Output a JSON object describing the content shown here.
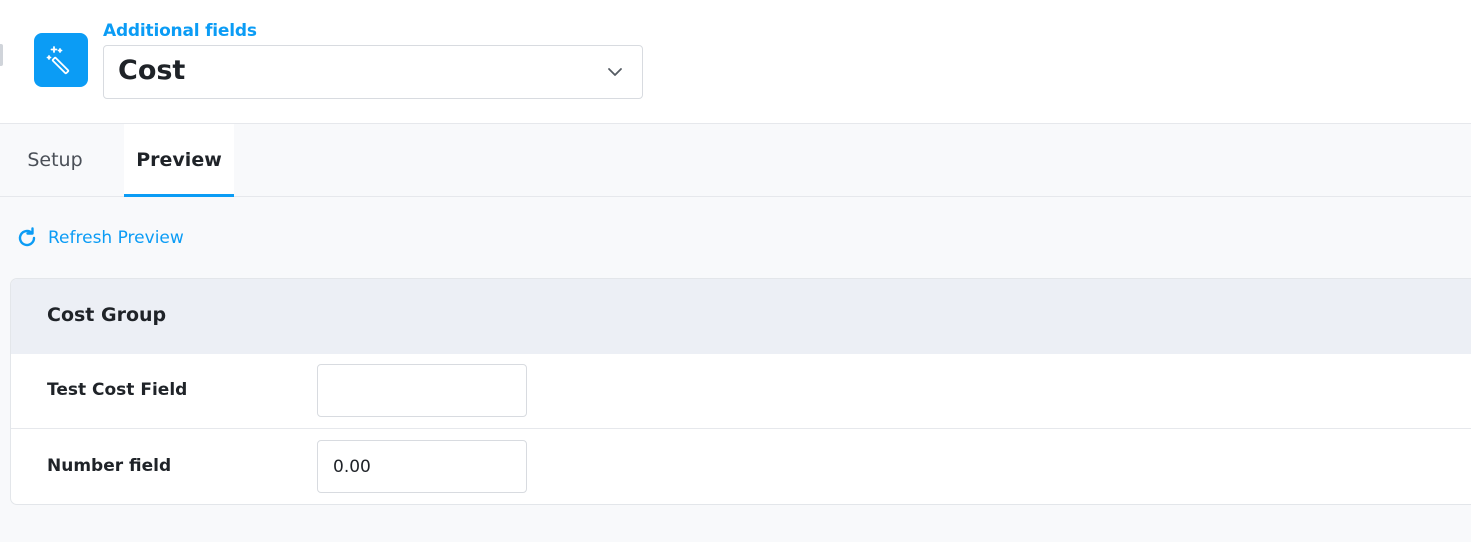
{
  "header": {
    "eyebrow": "Additional fields",
    "selected_field": "Cost",
    "app_icon": "magic-wand-icon",
    "accent_color": "#0b9cf5"
  },
  "tabs": [
    {
      "label": "Setup",
      "active": false
    },
    {
      "label": "Preview",
      "active": true
    }
  ],
  "preview": {
    "refresh_label": "Refresh Preview",
    "refresh_icon": "refresh-icon",
    "group": {
      "title": "Cost Group",
      "fields": [
        {
          "label": "Test Cost Field",
          "value": ""
        },
        {
          "label": "Number field",
          "value": "0.00"
        }
      ]
    }
  }
}
